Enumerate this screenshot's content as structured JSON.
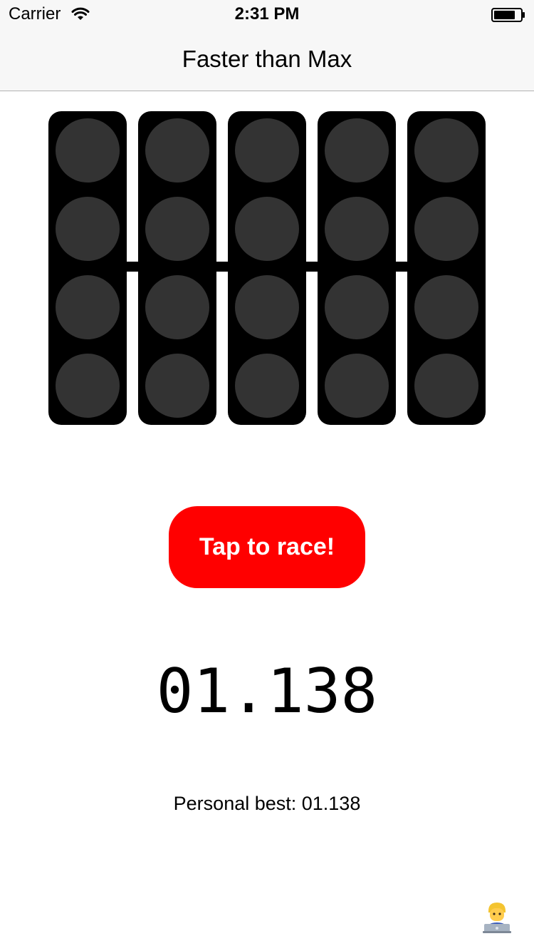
{
  "status_bar": {
    "carrier": "Carrier",
    "time": "2:31 PM",
    "wifi_icon": "wifi-icon",
    "battery_icon": "battery-full-icon"
  },
  "nav": {
    "title": "Faster than Max"
  },
  "start_lights": {
    "pods": 5,
    "lamps_per_pod": 4,
    "lamp_color_off": "#333333",
    "housing_color": "#000000"
  },
  "race_button": {
    "label": "Tap to race!",
    "color": "#ff0000"
  },
  "timer": {
    "value": "01.138"
  },
  "personal_best": {
    "text": "Personal best: 01.138"
  },
  "about_button": {
    "icon": "developer-emoji-icon"
  }
}
